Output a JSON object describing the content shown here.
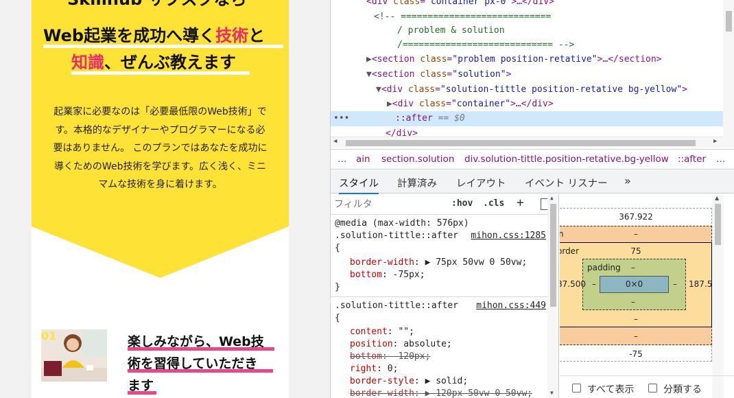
{
  "preview": {
    "heading_cut": "Skillhub サブスクなら",
    "heading_line1_pre": "Web起業を成功へ導く",
    "heading_line1_pink": "技術",
    "heading_line1_post": "と",
    "heading_line2_pink": "知識",
    "heading_line2_post": "、ぜんぶ教えます",
    "body": "起業家に必要なのは「必要最低限のWeb技術」です。本格的なデザイナーやプログラマーになる必要はありません。 このプランではあなたを成功に導くためのWeb技術を学びます。広く浅く、ミニマムな技術を身に着けます。",
    "feature_number": "01",
    "feature_title_lines": [
      "楽しみながら、Web技",
      "術を習得していただき",
      "ます"
    ]
  },
  "dom": {
    "line0": {
      "tag": "div",
      "attr": "class",
      "val": "container px-0",
      "tail": "…</div>"
    },
    "comment1": "<!-- ============================",
    "comment2": "/ problem & solution",
    "comment3": "/============================ -->",
    "line4": {
      "tag": "section",
      "attr": "class",
      "val": "problem position-retative",
      "tail": "…</section>"
    },
    "line5": {
      "tag": "section",
      "attr": "class",
      "val": "solution"
    },
    "line6": {
      "tag": "div",
      "attr": "class",
      "val": "solution-tittle position-retative bg-yellow"
    },
    "line7": {
      "tag": "div",
      "attr": "class",
      "val": "container",
      "tail": "…</div>"
    },
    "line8_pseudo": "::after",
    "line8_eq": "== $0",
    "line9": "</div>",
    "ellipsis": "•••"
  },
  "breadcrumbs": [
    "…",
    "ain",
    "section.solution",
    "div.solution-tittle.position-retative.bg-yellow",
    "::after",
    "…"
  ],
  "tabs": [
    "スタイル",
    "計算済み",
    "レイアウト",
    "イベント リスナー",
    "»"
  ],
  "styles": {
    "filter_placeholder": "フィルタ",
    "hov": ":hov",
    "cls": ".cls",
    "plus": "+",
    "media": "@media (max-width: 576px)",
    "rule1_selector": ".solution-tittle::after",
    "rule1_source": "mihon.css:1285",
    "rule1_props": [
      {
        "name": "border-width",
        "value": "▶ 75px 50vw 0 50vw;"
      },
      {
        "name": "bottom",
        "value": "-75px;"
      }
    ],
    "rule2_selector": ".solution-tittle::after",
    "rule2_source": "mihon.css:449",
    "rule2_props": [
      {
        "name": "content",
        "value": "\"\";"
      },
      {
        "name": "position",
        "value": "absolute;"
      },
      {
        "name": "bottom",
        "value": "-120px;"
      },
      {
        "name": "right",
        "value": "0;"
      },
      {
        "name": "border-style",
        "value": "▶ solid;"
      },
      {
        "name": "border-width",
        "value": "▶ 120px 50vw 0 50vw;"
      }
    ],
    "open_brace": "{",
    "close_brace": "}"
  },
  "box_model": {
    "top_width": "367.922",
    "margin_label": "n",
    "margin_top": "–",
    "border_label": "order",
    "border_top": "75",
    "padding_label": "padding",
    "padding_top": "–",
    "padding_left": "–",
    "padding_right": "–",
    "padding_bottom": "–",
    "content": "0×0",
    "left_value": "87.500",
    "right_value": "187.50",
    "border_bottom": "–",
    "margin_bottom": "–",
    "position_bottom": "-75",
    "show_all": "すべて表示",
    "group": "分類する"
  },
  "colors": {
    "yellow": "#ffe236",
    "pink": "#ef2a68",
    "highlight": "#cfe8fc"
  }
}
